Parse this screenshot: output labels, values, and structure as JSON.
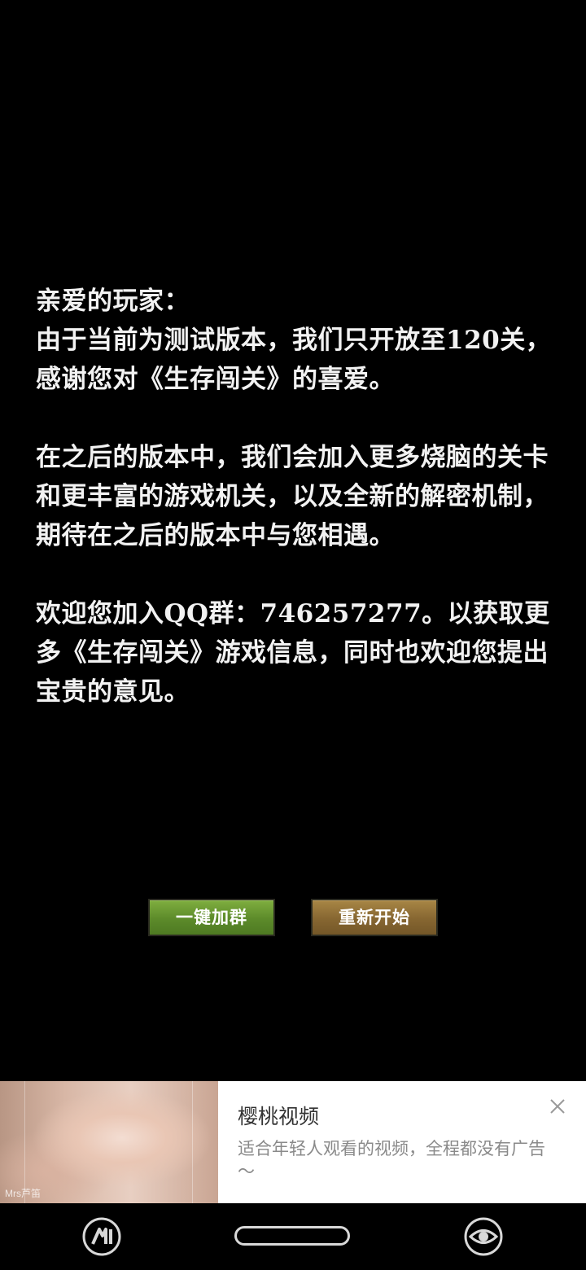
{
  "letter": {
    "greeting": "亲爱的玩家：",
    "line1": "由于当前为测试版本，我们只开放至120关，感谢您对《生存闯关》的喜爱。",
    "paragraph2": "在之后的版本中，我们会加入更多烧脑的关卡和更丰富的游戏机关，以及全新的解密机制，期待在之后的版本中与您相遇。",
    "paragraph3": "欢迎您加入QQ群：746257277。以获取更多《生存闯关》游戏信息，同时也欢迎您提出宝贵的意见。"
  },
  "buttons": {
    "join_group": "一键加群",
    "restart": "重新开始"
  },
  "ad": {
    "title": "樱桃视频",
    "description": "适合年轻人观看的视频，全程都没有广告～",
    "image_mark": "Mrs芦笛"
  },
  "colors": {
    "background": "#000000",
    "text": "#f2f2f2",
    "join_button": "#5c8a2a",
    "restart_button": "#866631"
  },
  "icons": {
    "ad_close": "close-icon",
    "nav_left": "app-logo-icon",
    "nav_right": "eye-icon"
  }
}
